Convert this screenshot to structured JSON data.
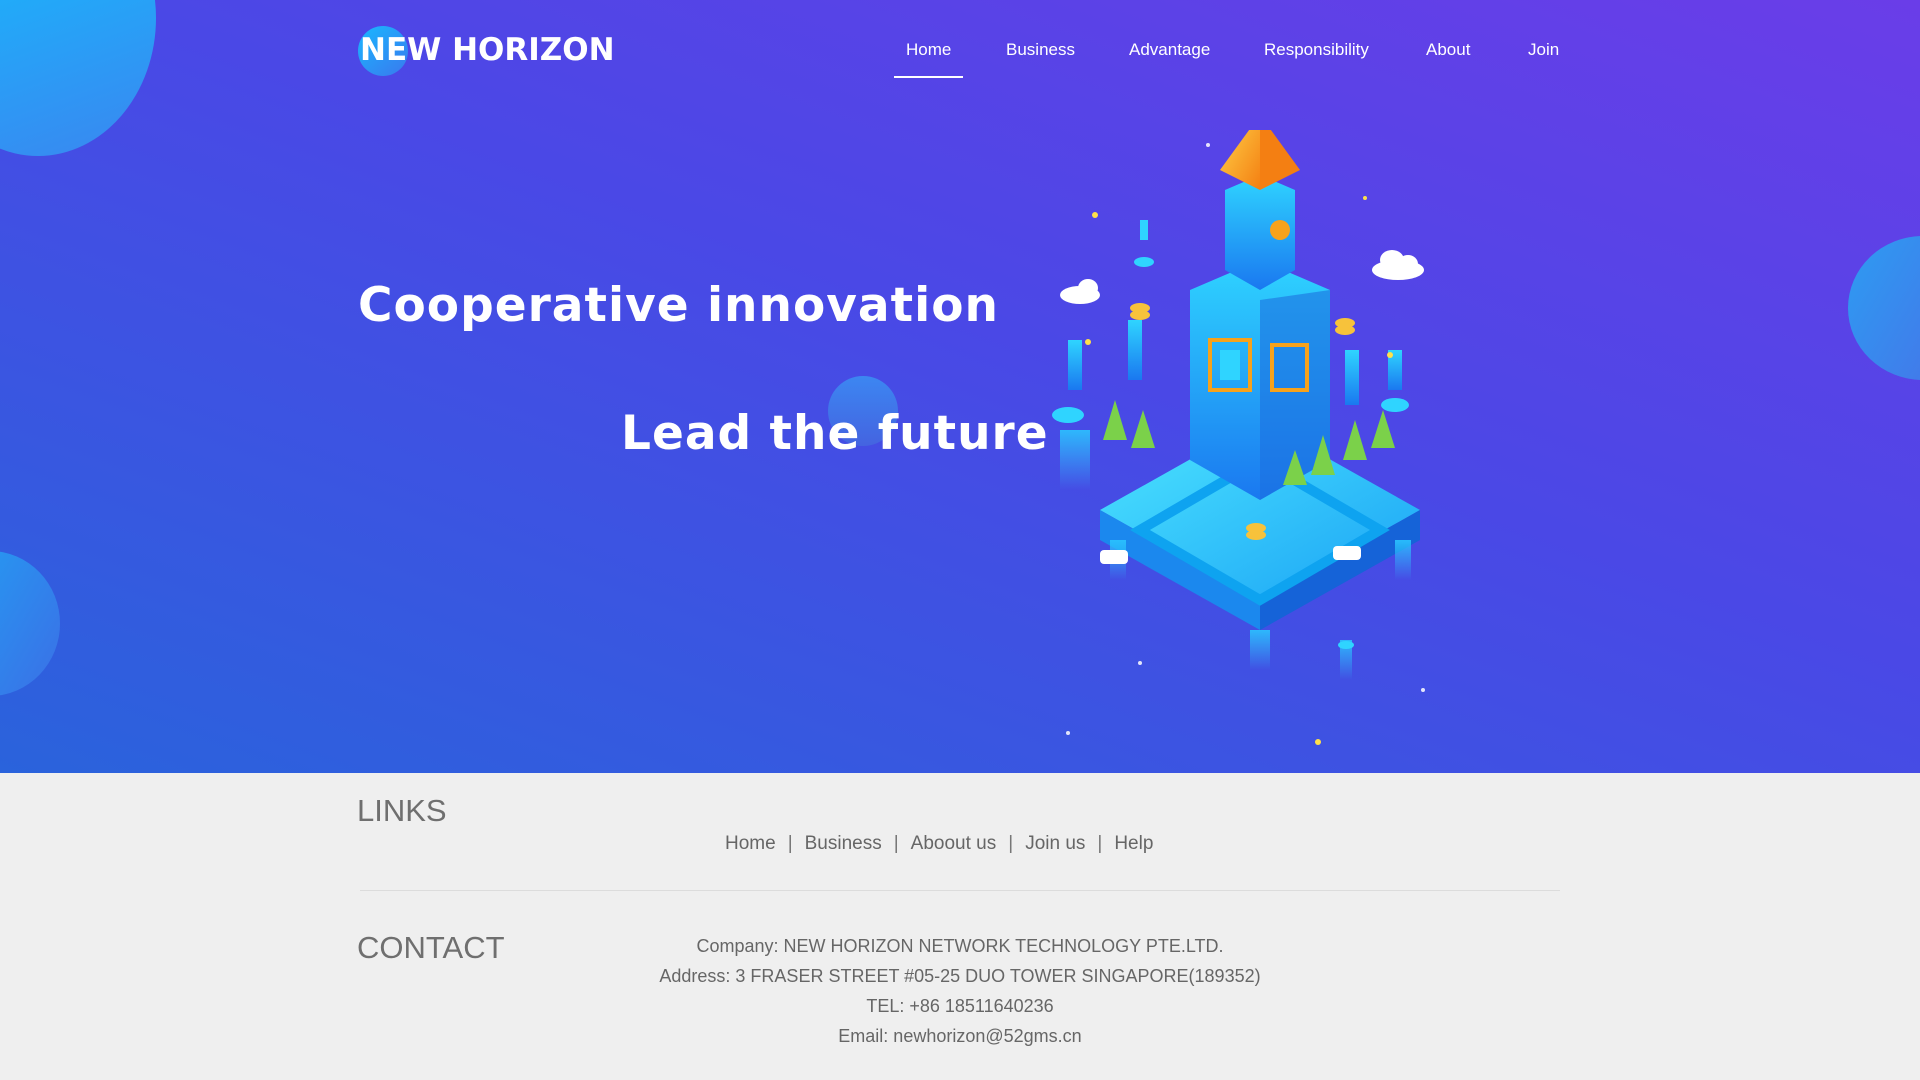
{
  "logo": {
    "text": "NEW HORIZON"
  },
  "nav": {
    "items": [
      {
        "label": "Home",
        "active": true
      },
      {
        "label": "Business",
        "active": false
      },
      {
        "label": "Advantage",
        "active": false
      },
      {
        "label": "Responsibility",
        "active": false
      },
      {
        "label": "About",
        "active": false
      },
      {
        "label": "Join",
        "active": false
      }
    ]
  },
  "hero": {
    "headline_1": "Cooperative innovation",
    "headline_2": "Lead the future"
  },
  "footer": {
    "links_title": "LINKS",
    "links": [
      "Home",
      "Business",
      "Aboout us",
      "Join us",
      "Help"
    ],
    "contact_title": "CONTACT",
    "company": "Company: NEW HORIZON NETWORK TECHNOLOGY PTE.LTD.",
    "address": "Address: 3 FRASER STREET #05-25 DUO TOWER SINGAPORE(189352)",
    "tel": "TEL: +86 18511640236",
    "email": "Email: newhorizon@52gms.cn"
  },
  "colors": {
    "hero_gradient_top": "#6a3de8",
    "hero_gradient_bottom": "#2a63dc",
    "footer_bg": "#efefef",
    "accent_cyan": "#19b8ff",
    "accent_orange": "#f7a21b"
  }
}
